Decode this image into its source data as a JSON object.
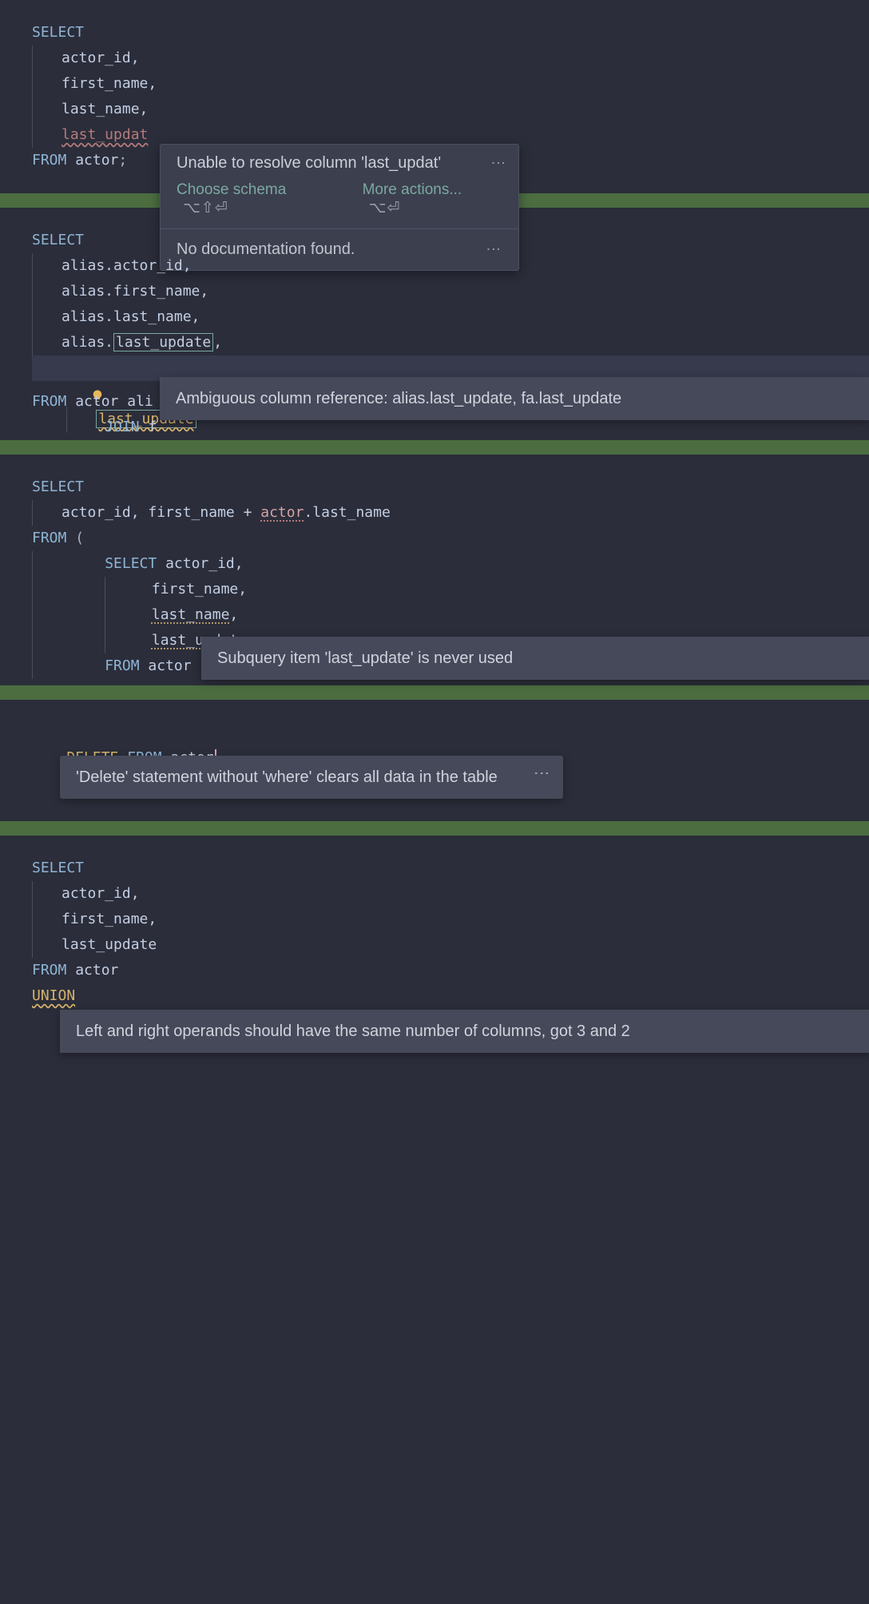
{
  "block1": {
    "kw_select": "SELECT",
    "cols": [
      "actor_id,",
      "first_name,",
      "last_name,"
    ],
    "err_col": "last_updat",
    "kw_from": "FROM",
    "table": "actor",
    "semi": ";"
  },
  "popup1": {
    "title": "Unable to resolve column 'last_updat'",
    "action_schema": "Choose schema",
    "kbd_schema": "⌥⇧⏎",
    "action_more": "More actions...",
    "kbd_more": "⌥⏎",
    "doc": "No documentation found."
  },
  "block2": {
    "kw_select": "SELECT",
    "lines": [
      "alias.actor_id,",
      "alias.first_name,",
      "alias.last_name,",
      "alias.|last_update|,",
      "last_update"
    ],
    "col_boxed": "last_update",
    "col_warn": "last_update",
    "kw_from": "FROM",
    "table": "actor",
    "alias": "ali",
    "kw_join": "JOIN",
    "join_letter": "f"
  },
  "tooltip2": "Ambiguous column reference: alias.last_update, fa.last_update",
  "block3": {
    "kw_select": "SELECT",
    "outer_line_cols": "actor_id, first_name + ",
    "outer_err": "actor",
    "outer_tail": ".last_name",
    "kw_from_open": "FROM (",
    "inner_select": "SELECT",
    "inner_col1": "actor_id,",
    "inner_col2": "first_name,",
    "inner_col3": "last_name",
    "inner_col4": "last_update",
    "inner_from": "FROM",
    "inner_table": "actor"
  },
  "tooltip3": "Subquery item 'last_update' is never used",
  "block4": {
    "kw_delete": "DELETE",
    "kw_from": "FROM",
    "table": "actor"
  },
  "tooltip4": "'Delete' statement without 'where' clears all data in the table",
  "block5": {
    "kw_select": "SELECT",
    "cols": [
      "actor_id,",
      "first_name,",
      "last_update"
    ],
    "kw_from": "FROM",
    "table": "actor",
    "kw_union": "UNION"
  },
  "tooltip5": "Left and right operands should have the same number of columns, got 3 and 2"
}
